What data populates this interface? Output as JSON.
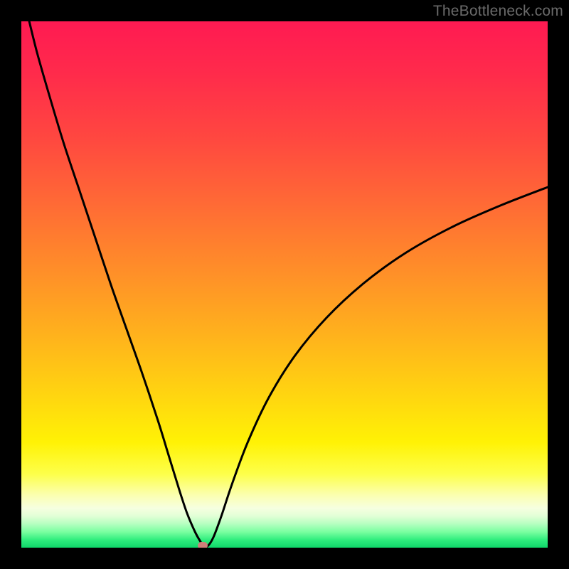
{
  "watermark": "TheBottleneck.com",
  "chart_data": {
    "type": "line",
    "title": "",
    "xlabel": "",
    "ylabel": "",
    "xlim": [
      0,
      100
    ],
    "ylim": [
      0,
      100
    ],
    "grid": false,
    "legend": false,
    "background_gradient": {
      "stops": [
        {
          "pos": 0.0,
          "color": "#ff1a52"
        },
        {
          "pos": 0.1,
          "color": "#ff2b4b"
        },
        {
          "pos": 0.22,
          "color": "#ff4740"
        },
        {
          "pos": 0.35,
          "color": "#ff6b35"
        },
        {
          "pos": 0.48,
          "color": "#ff9028"
        },
        {
          "pos": 0.6,
          "color": "#ffb31c"
        },
        {
          "pos": 0.72,
          "color": "#ffd80f"
        },
        {
          "pos": 0.8,
          "color": "#fff205"
        },
        {
          "pos": 0.86,
          "color": "#fdff4a"
        },
        {
          "pos": 0.9,
          "color": "#fbffb0"
        },
        {
          "pos": 0.925,
          "color": "#f6ffe0"
        },
        {
          "pos": 0.94,
          "color": "#e2ffd6"
        },
        {
          "pos": 0.955,
          "color": "#b5ffc0"
        },
        {
          "pos": 0.97,
          "color": "#7affa0"
        },
        {
          "pos": 0.985,
          "color": "#30ee7e"
        },
        {
          "pos": 1.0,
          "color": "#0fd76a"
        }
      ]
    },
    "series": [
      {
        "name": "bottleneck-curve",
        "color": "#000000",
        "x": [
          1.5,
          3,
          5,
          8,
          11,
          14,
          17,
          20,
          23,
          26,
          28,
          30,
          31.5,
          33,
          34,
          34.7,
          35.5,
          36.5,
          38,
          40,
          43,
          47,
          52,
          58,
          65,
          73,
          82,
          91,
          100
        ],
        "y": [
          100,
          94,
          87,
          77,
          68,
          59,
          50,
          41.5,
          33,
          24,
          17.5,
          11,
          6.5,
          3,
          1.2,
          0.2,
          0.4,
          2,
          6,
          12,
          20,
          28.5,
          36.5,
          43.7,
          50.2,
          56,
          61,
          65,
          68.5
        ]
      }
    ],
    "marker": {
      "x": 34.5,
      "y": 0.4,
      "color": "#cf7f7a"
    }
  }
}
